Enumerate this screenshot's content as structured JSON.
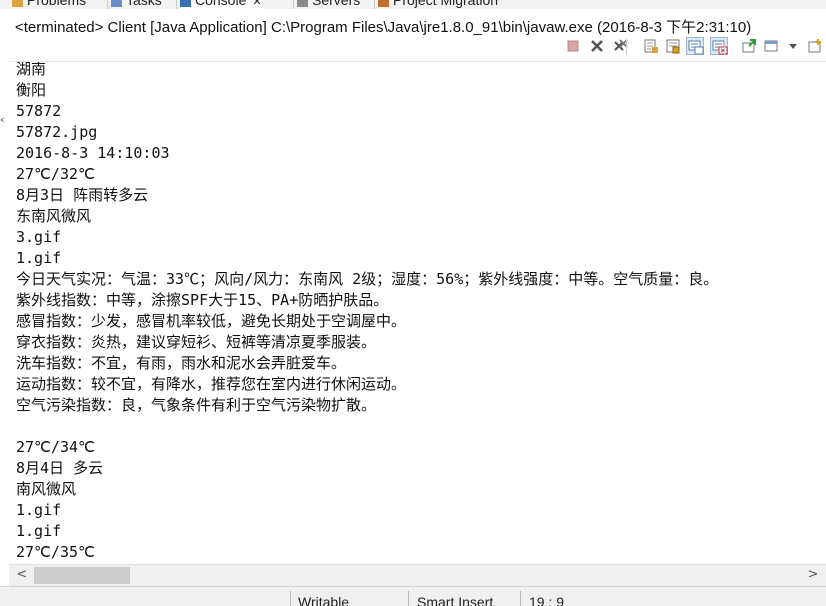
{
  "tabs": [
    {
      "label": "Problems",
      "icon": "problems-icon"
    },
    {
      "label": "Tasks",
      "icon": "tasks-icon"
    },
    {
      "label": "Console",
      "icon": "console-icon",
      "close": "✕",
      "active": true
    },
    {
      "label": "Servers",
      "icon": "servers-icon"
    },
    {
      "label": "Project Migration",
      "icon": "migration-icon"
    }
  ],
  "console_title": "<terminated> Client [Java Application] C:\\Program Files\\Java\\jre1.8.0_91\\bin\\javaw.exe (2016-8-3 下午2:31:10)",
  "toolbar": [
    {
      "icon": "terminate-icon"
    },
    {
      "icon": "remove-launch-icon"
    },
    {
      "icon": "remove-all-terminated-icon"
    },
    {
      "icon": "clear-console-icon"
    },
    {
      "icon": "scroll-lock-icon"
    },
    {
      "icon": "show-on-stdout-icon",
      "pressed": true
    },
    {
      "icon": "show-on-stderr-icon",
      "pressed": true
    },
    {
      "icon": "pin-console-icon"
    },
    {
      "icon": "display-console-icon"
    },
    {
      "icon": "dropdown-arrow-icon"
    },
    {
      "icon": "open-console-icon"
    }
  ],
  "console_lines": [
    "湖南",
    "衡阳",
    "57872",
    "57872.jpg",
    "2016-8-3 14:10:03",
    "27℃/32℃",
    "8月3日 阵雨转多云",
    "东南风微风",
    "3.gif",
    "1.gif",
    "今日天气实况：气温：33℃；风向/风力：东南风 2级；湿度：56%；紫外线强度：中等。空气质量：良。",
    "紫外线指数：中等，涂擦SPF大于15、PA+防晒护肤品。",
    "感冒指数：少发，感冒机率较低，避免长期处于空调屋中。",
    "穿衣指数：炎热，建议穿短衫、短裤等清凉夏季服装。",
    "洗车指数：不宜，有雨，雨水和泥水会弄脏爱车。",
    "运动指数：较不宜，有降水，推荐您在室内进行休闲运动。",
    "空气污染指数：良，气象条件有利于空气污染物扩散。",
    "",
    "27℃/34℃",
    "8月4日 多云",
    "南风微风",
    "1.gif",
    "1.gif",
    "27℃/35℃"
  ],
  "scrollbar": {
    "left_arrow": "<",
    "right_arrow": ">"
  },
  "status": {
    "writable": "Writable",
    "insert_mode": "Smart Insert",
    "position": "19 : 9"
  },
  "colors": {
    "background": "#ffffff",
    "chrome": "#f0f0f0",
    "text": "#111111"
  }
}
